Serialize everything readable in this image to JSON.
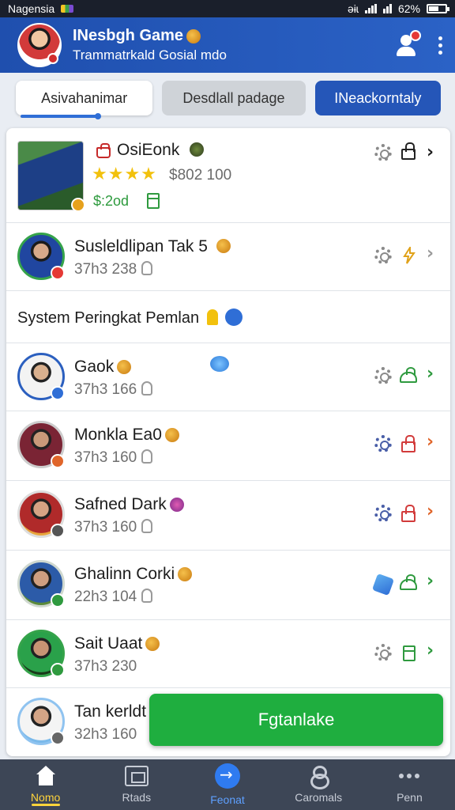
{
  "status_bar": {
    "carrier": "Nagensia",
    "right_text": "əɨɩ",
    "battery": "62%",
    "battery_level": 0.62
  },
  "app_bar": {
    "title": "INesbgh Game",
    "subtitle": "Trammatrkald Gosial mdo"
  },
  "tabs": [
    {
      "label": "Asivahanimar",
      "state": "selected"
    },
    {
      "label": "Desdlall padage",
      "state": "gray"
    },
    {
      "label": "INeackorntaly",
      "state": "primary"
    }
  ],
  "featured": {
    "name": "OsiEonk",
    "rating_stars": 4,
    "price": "$802 100",
    "amount": "$:2od"
  },
  "players_top": [
    {
      "name": "Susleldlipan Tak 5",
      "meta": "37h3 238"
    }
  ],
  "section_title": "System Peringkat Pemlan",
  "players": [
    {
      "name": "Gaok",
      "meta": "37h3 166",
      "icons": [
        "gear",
        "cloud"
      ],
      "chevron": "green"
    },
    {
      "name": "Monkla Ea0",
      "meta": "37h3 160",
      "icons": [
        "gear-blue",
        "lock-red"
      ],
      "chevron": "orange"
    },
    {
      "name": "Safned Dark",
      "meta": "37h3 160",
      "icons": [
        "gear-blue",
        "lock-red"
      ],
      "chevron": "orange"
    },
    {
      "name": "Ghalinn Corki",
      "meta": "22h3 104",
      "icons": [
        "cube",
        "cloud"
      ],
      "chevron": "green"
    },
    {
      "name": "Sait Uaat",
      "meta": "37h3 230",
      "icons": [
        "gear",
        "doc"
      ],
      "chevron": "green"
    },
    {
      "name": "Tan kerldt",
      "meta": "32h3 160"
    }
  ],
  "cta_label": "Fgtanlake",
  "bottom_nav": [
    {
      "label": "Nomo",
      "icon": "home-icon",
      "state": "active"
    },
    {
      "label": "Rtads",
      "icon": "calendar-icon"
    },
    {
      "label": "Feonat",
      "icon": "arrow-icon",
      "state": "highlight"
    },
    {
      "label": "Caromals",
      "icon": "figure-icon"
    },
    {
      "label": "Penn",
      "icon": "more-icon"
    }
  ],
  "colors": {
    "primary": "#2556b8",
    "accent_green": "#1fae3f",
    "star": "#f2c10d",
    "nav_bg": "#3d4656"
  }
}
